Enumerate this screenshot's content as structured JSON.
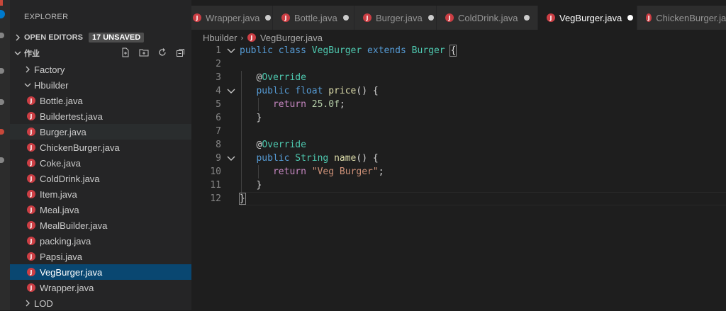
{
  "sidebar": {
    "title": "EXPLORER",
    "open_editors_label": "OPEN EDITORS",
    "unsaved_badge": "17 UNSAVED",
    "workspace_label": "作业",
    "toolbar_icons": [
      "new-file-icon",
      "new-folder-icon",
      "refresh-icon",
      "collapse-all-icon"
    ],
    "tree": [
      {
        "label": "Factory",
        "type": "folder",
        "expanded": false
      },
      {
        "label": "Hbuilder",
        "type": "folder",
        "expanded": true
      },
      {
        "label": "Bottle.java",
        "type": "file"
      },
      {
        "label": "Buildertest.java",
        "type": "file"
      },
      {
        "label": "Burger.java",
        "type": "file",
        "hover": true
      },
      {
        "label": "ChickenBurger.java",
        "type": "file"
      },
      {
        "label": "Coke.java",
        "type": "file"
      },
      {
        "label": "ColdDrink.java",
        "type": "file"
      },
      {
        "label": "Item.java",
        "type": "file"
      },
      {
        "label": "Meal.java",
        "type": "file"
      },
      {
        "label": "MealBuilder.java",
        "type": "file"
      },
      {
        "label": "packing.java",
        "type": "file"
      },
      {
        "label": "Papsi.java",
        "type": "file"
      },
      {
        "label": "VegBurger.java",
        "type": "file",
        "selected": true
      },
      {
        "label": "Wrapper.java",
        "type": "file"
      },
      {
        "label": "LOD",
        "type": "folder",
        "expanded": false
      }
    ]
  },
  "tabs": [
    {
      "label": "Wrapper.java",
      "active": false
    },
    {
      "label": "Bottle.java",
      "active": false
    },
    {
      "label": "Burger.java",
      "active": false
    },
    {
      "label": "ColdDrink.java",
      "active": false
    },
    {
      "label": "VegBurger.java",
      "active": true
    },
    {
      "label": "ChickenBurger.java",
      "active": false
    }
  ],
  "breadcrumb": {
    "folder": "Hbuilder",
    "file": "VegBurger.java"
  },
  "file_icon_letter": "J",
  "colors": {
    "java_icon": "#cc3e44",
    "selection": "#094771",
    "keyword": "#569cd6",
    "type": "#4ec9b0",
    "function": "#dcdcaa",
    "number": "#b5cea8",
    "string": "#ce9178",
    "control": "#c586c0"
  },
  "editor": {
    "line_numbers": [
      "1",
      "2",
      "3",
      "4",
      "5",
      "6",
      "7",
      "8",
      "9",
      "10",
      "11",
      "12"
    ],
    "code": {
      "l1_kw1": "public",
      "l1_kw2": "class",
      "l1_name": "VegBurger",
      "l1_kw3": "extends",
      "l1_super": "Burger",
      "l1_brace": "{",
      "l3_at": "@",
      "l3_ann": "Override",
      "l4_kw1": "public",
      "l4_type": "float",
      "l4_fn": "price",
      "l4_rest": "() {",
      "l5_ret": "return",
      "l5_num": "25.0f",
      "l5_semi": ";",
      "l6_brace": "}",
      "l8_at": "@",
      "l8_ann": "Override",
      "l9_kw1": "public",
      "l9_type": "String",
      "l9_fn": "name",
      "l9_rest": "() {",
      "l10_ret": "return",
      "l10_str": "\"Veg Burger\"",
      "l10_semi": ";",
      "l11_brace": "}",
      "l12_brace": "}"
    }
  }
}
